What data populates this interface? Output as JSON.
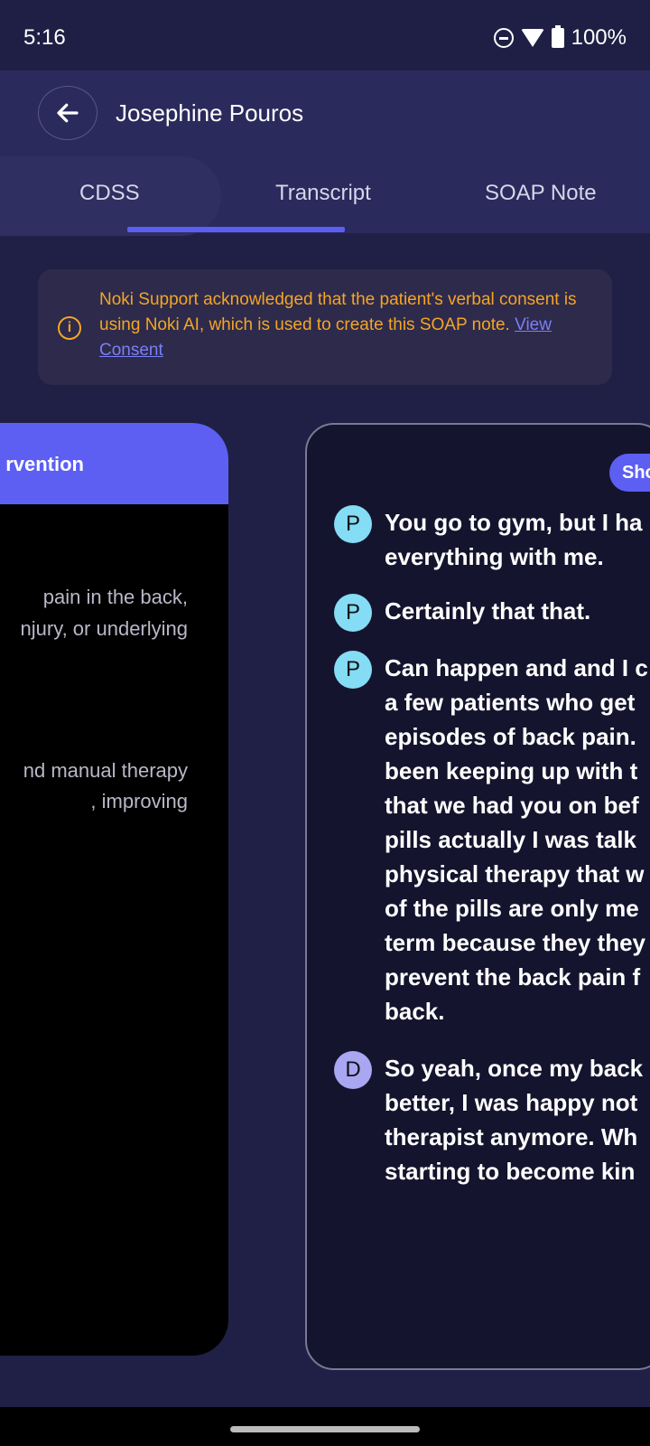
{
  "status": {
    "time": "5:16",
    "battery": "100%"
  },
  "header": {
    "patient_name": "Josephine Pouros"
  },
  "tabs": [
    {
      "label": "CDSS"
    },
    {
      "label": "Transcript"
    },
    {
      "label": "SOAP Note"
    }
  ],
  "consent": {
    "text": "Noki Support acknowledged that the patient's verbal consent is using Noki AI, which is used to create this SOAP note. ",
    "link": "View Consent",
    "color": "#f5a524"
  },
  "left_card": {
    "title": "rvention",
    "lines": [
      "pain in the back,",
      "njury, or underlying",
      "nd manual therapy",
      ", improving"
    ]
  },
  "transcript": {
    "chip_label": "Sho",
    "messages": [
      {
        "speaker": "P",
        "text": "You go to gym, but I ha\neverything with me."
      },
      {
        "speaker": "P",
        "text": "Certainly that that."
      },
      {
        "speaker": "P",
        "text": "Can happen and and I c\na few patients who get\nepisodes of back pain.\nbeen keeping up with t\nthat we had you on bef\npills actually I was talk\nphysical therapy that w\nof the pills are only me\nterm because they they\nprevent the back pain f\nback."
      },
      {
        "speaker": "D",
        "text": "So yeah, once my back\nbetter, I was happy not\ntherapist anymore. Wh\nstarting to become kin"
      }
    ]
  },
  "colors": {
    "accent": "#5c5ff2",
    "background": "#202046",
    "header": "#2a2a5c"
  }
}
